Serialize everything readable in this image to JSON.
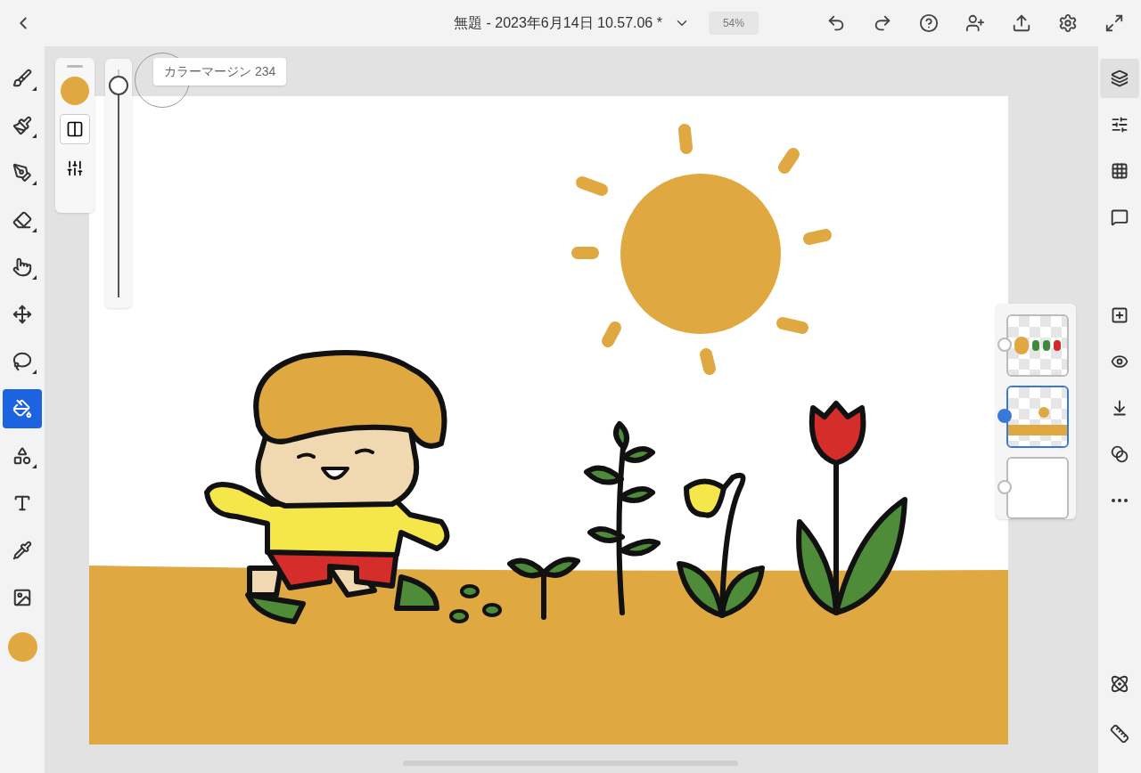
{
  "top_bar": {
    "title": "無題 - 2023年6月14日 10.57.06 *",
    "zoom": "54%"
  },
  "tools": [
    {
      "kind": "pixel-brush",
      "selected": false,
      "submenu": true
    },
    {
      "kind": "watercolor-brush",
      "selected": false,
      "submenu": true
    },
    {
      "kind": "vector-brush",
      "selected": false,
      "submenu": true
    },
    {
      "kind": "eraser",
      "selected": false,
      "submenu": true
    },
    {
      "kind": "smudge",
      "selected": false,
      "submenu": true
    },
    {
      "kind": "move",
      "selected": false,
      "submenu": false
    },
    {
      "kind": "lasso",
      "selected": false,
      "submenu": true
    },
    {
      "kind": "fill",
      "selected": true,
      "submenu": false
    },
    {
      "kind": "shapes",
      "selected": false,
      "submenu": true
    },
    {
      "kind": "text",
      "selected": false,
      "submenu": false
    },
    {
      "kind": "eyedropper",
      "selected": false,
      "submenu": false
    },
    {
      "kind": "image",
      "selected": false,
      "submenu": false
    }
  ],
  "current_color": {
    "color": "#e0a841"
  },
  "tool_panel": {
    "color": "#e0a841",
    "blend_selected": true,
    "slider": {
      "level": 0.93
    },
    "tooltip": "カラーマージン 234"
  },
  "right_tools": [
    {
      "kind": "layers",
      "selected": true
    },
    {
      "kind": "adjust",
      "selected": false
    },
    {
      "kind": "grid",
      "selected": false
    },
    {
      "kind": "comment",
      "selected": false
    },
    {
      "kind": "spacer"
    },
    {
      "kind": "add-layer",
      "selected": false
    },
    {
      "kind": "visibility",
      "selected": false
    },
    {
      "kind": "merge-down",
      "selected": false
    },
    {
      "kind": "blend",
      "selected": false
    },
    {
      "kind": "more",
      "selected": false
    }
  ],
  "layers": [
    {
      "kind": "characters",
      "selected": false
    },
    {
      "kind": "sun-ground",
      "selected": true
    },
    {
      "kind": "background",
      "selected": false
    }
  ],
  "bottom_tools": [
    {
      "kind": "effects"
    },
    {
      "kind": "ruler"
    }
  ]
}
